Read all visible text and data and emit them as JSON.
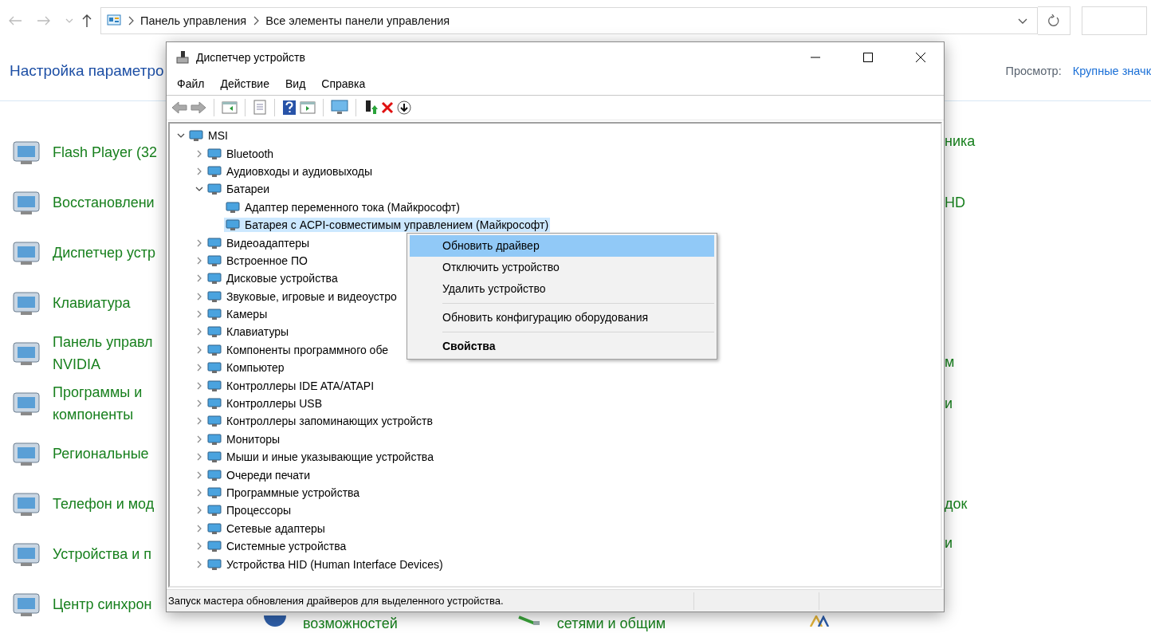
{
  "address_bar": {
    "breadcrumbs": [
      "Панель управления",
      "Все элементы панели управления"
    ]
  },
  "header": {
    "title": "Настройка параметро",
    "view_label": "Просмотр:",
    "view_value": "Крупные значк"
  },
  "left_items": [
    {
      "lines": [
        "Flash Player (32"
      ]
    },
    {
      "lines": [
        "Восстановлени"
      ]
    },
    {
      "lines": [
        "Диспетчер устр"
      ]
    },
    {
      "lines": [
        "Клавиатура"
      ]
    },
    {
      "lines": [
        "Панель управл",
        "NVIDIA"
      ]
    },
    {
      "lines": [
        "Программы и",
        "компоненты"
      ]
    },
    {
      "lines": [
        "Региональные"
      ]
    },
    {
      "lines": [
        "Телефон и мод"
      ]
    },
    {
      "lines": [
        "Устройства и п"
      ]
    },
    {
      "lines": [
        "Центр синхрон"
      ]
    }
  ],
  "right_fragments": [
    "ника",
    "HD",
    "м",
    "и",
    "док",
    "и"
  ],
  "bottom_fragments": [
    "возможностей",
    "сетями и общим"
  ],
  "device_manager": {
    "title": "Диспетчер устройств",
    "menu": [
      "Файл",
      "Действие",
      "Вид",
      "Справка"
    ],
    "tree": {
      "label": "MSI",
      "expanded": true,
      "selected": false,
      "children": [
        {
          "label": "Bluetooth",
          "expanded": false,
          "selected": false
        },
        {
          "label": "Аудиовходы и аудиовыходы",
          "expanded": false,
          "selected": false
        },
        {
          "label": "Батареи",
          "expanded": true,
          "selected": false,
          "children": [
            {
              "label": "Адаптер переменного тока (Майкрософт)",
              "selected": false
            },
            {
              "label": "Батарея с ACPI-совместимым управлением (Майкрософт)",
              "selected": true
            }
          ]
        },
        {
          "label": "Видеоадаптеры",
          "expanded": false,
          "selected": false
        },
        {
          "label": "Встроенное ПО",
          "expanded": false,
          "selected": false
        },
        {
          "label": "Дисковые устройства",
          "expanded": false,
          "selected": false
        },
        {
          "label": "Звуковые, игровые и видеоустро",
          "expanded": false,
          "selected": false
        },
        {
          "label": "Камеры",
          "expanded": false,
          "selected": false
        },
        {
          "label": "Клавиатуры",
          "expanded": false,
          "selected": false
        },
        {
          "label": "Компоненты программного обе",
          "expanded": false,
          "selected": false
        },
        {
          "label": "Компьютер",
          "expanded": false,
          "selected": false
        },
        {
          "label": "Контроллеры IDE ATA/ATAPI",
          "expanded": false,
          "selected": false
        },
        {
          "label": "Контроллеры USB",
          "expanded": false,
          "selected": false
        },
        {
          "label": "Контроллеры запоминающих устройств",
          "expanded": false,
          "selected": false
        },
        {
          "label": "Мониторы",
          "expanded": false,
          "selected": false
        },
        {
          "label": "Мыши и иные указывающие устройства",
          "expanded": false,
          "selected": false
        },
        {
          "label": "Очереди печати",
          "expanded": false,
          "selected": false
        },
        {
          "label": "Программные устройства",
          "expanded": false,
          "selected": false
        },
        {
          "label": "Процессоры",
          "expanded": false,
          "selected": false
        },
        {
          "label": "Сетевые адаптеры",
          "expanded": false,
          "selected": false
        },
        {
          "label": "Системные устройства",
          "expanded": false,
          "selected": false
        },
        {
          "label": "Устройства HID (Human Interface Devices)",
          "expanded": false,
          "selected": false
        }
      ]
    },
    "status_text": "Запуск мастера обновления драйверов для выделенного устройства."
  },
  "context_menu": [
    {
      "kind": "item",
      "label": "Обновить драйвер",
      "selected": true
    },
    {
      "kind": "item",
      "label": "Отключить устройство",
      "selected": false
    },
    {
      "kind": "item",
      "label": "Удалить устройство",
      "selected": false
    },
    {
      "kind": "separator"
    },
    {
      "kind": "item",
      "label": "Обновить конфигурацию оборудования",
      "selected": false
    },
    {
      "kind": "separator"
    },
    {
      "kind": "default",
      "label": "Свойства",
      "selected": false
    }
  ]
}
